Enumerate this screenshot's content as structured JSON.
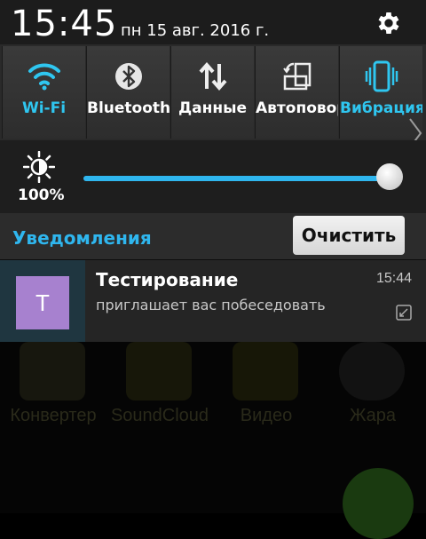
{
  "status": {
    "time": "15:45",
    "date": "пн 15 авг. 2016 г."
  },
  "toggles": [
    {
      "label": "Wi-Fi",
      "icon": "wifi-icon",
      "active": true
    },
    {
      "label": "Bluetooth",
      "icon": "bluetooth-icon",
      "active": false
    },
    {
      "label": "Данные",
      "icon": "data-arrows-icon",
      "active": false
    },
    {
      "label": "Автоповорот",
      "icon": "auto-rotate-icon",
      "active": false
    },
    {
      "label": "Вибрация",
      "icon": "vibrate-icon",
      "active": true
    }
  ],
  "brightness": {
    "percent_label": "100%",
    "level": 1.0
  },
  "notifications": {
    "title": "Уведомления",
    "clear_label": "Очистить",
    "items": [
      {
        "avatar_letter": "T",
        "title": "Тестирование",
        "text": "приглашает вас побеседовать",
        "time": "15:44"
      }
    ]
  },
  "background_apps": [
    {
      "label": "Конвертер"
    },
    {
      "label": "SoundCloud"
    },
    {
      "label": "Видео"
    },
    {
      "label": "Жара"
    }
  ],
  "colors": {
    "accent": "#2fb6ee",
    "avatar": "#a781cf"
  }
}
